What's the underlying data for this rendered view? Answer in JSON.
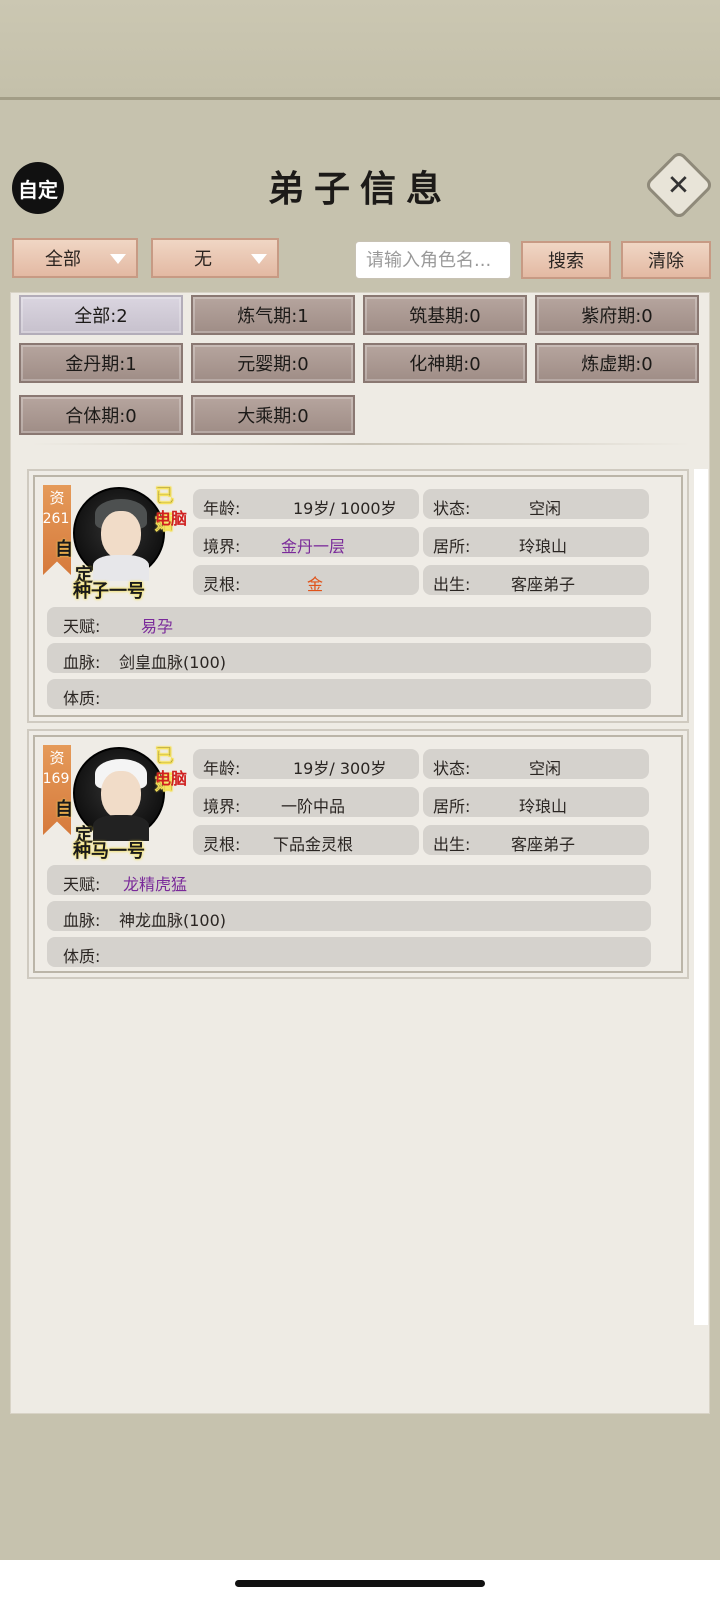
{
  "header": {
    "avatar_text": "自定",
    "title": "弟子信息",
    "close_icon": "close-icon"
  },
  "toolbar": {
    "filter_a": "全部",
    "filter_b": "无",
    "search_placeholder": "请输入角色名...",
    "search_label": "搜索",
    "clear_label": "清除"
  },
  "realms": [
    {
      "label": "全部:2",
      "active": true
    },
    {
      "label": "炼气期:1"
    },
    {
      "label": "筑基期:0"
    },
    {
      "label": "紫府期:0"
    },
    {
      "label": "金丹期:1"
    },
    {
      "label": "元婴期:0"
    },
    {
      "label": "化神期:0"
    },
    {
      "label": "炼虚期:0"
    },
    {
      "label": "合体期:0"
    },
    {
      "label": "大乘期:0"
    }
  ],
  "disciples": [
    {
      "aptitude_label": "资",
      "aptitude": "261",
      "married": "已婚",
      "pc": "电脑",
      "custom_1": "自",
      "custom_2": "定",
      "name": "种子一号",
      "age_label": "年龄:",
      "age": "19岁/ 1000岁",
      "status_label": "状态:",
      "status": "空闲",
      "realm_label": "境界:",
      "realm": "金丹一层",
      "residence_label": "居所:",
      "residence": "玲琅山",
      "root_label": "灵根:",
      "root": "金",
      "birth_label": "出生:",
      "birth": "客座弟子",
      "talent_label": "天赋:",
      "talent": "易孕",
      "bloodline_label": "血脉:",
      "bloodline": "剑皇血脉(100)",
      "physique_label": "体质:",
      "physique": ""
    },
    {
      "aptitude_label": "资",
      "aptitude": "169",
      "married": "已婚",
      "pc": "电脑",
      "custom_1": "自",
      "custom_2": "定",
      "name": "种马一号",
      "age_label": "年龄:",
      "age": "19岁/ 300岁",
      "status_label": "状态:",
      "status": "空闲",
      "realm_label": "境界:",
      "realm": "一阶中品",
      "residence_label": "居所:",
      "residence": "玲琅山",
      "root_label": "灵根:",
      "root": "下品金灵根",
      "birth_label": "出生:",
      "birth": "客座弟子",
      "talent_label": "天赋:",
      "talent": "龙精虎猛",
      "bloodline_label": "血脉:",
      "bloodline": "神龙血脉(100)",
      "physique_label": "体质:",
      "physique": ""
    }
  ]
}
